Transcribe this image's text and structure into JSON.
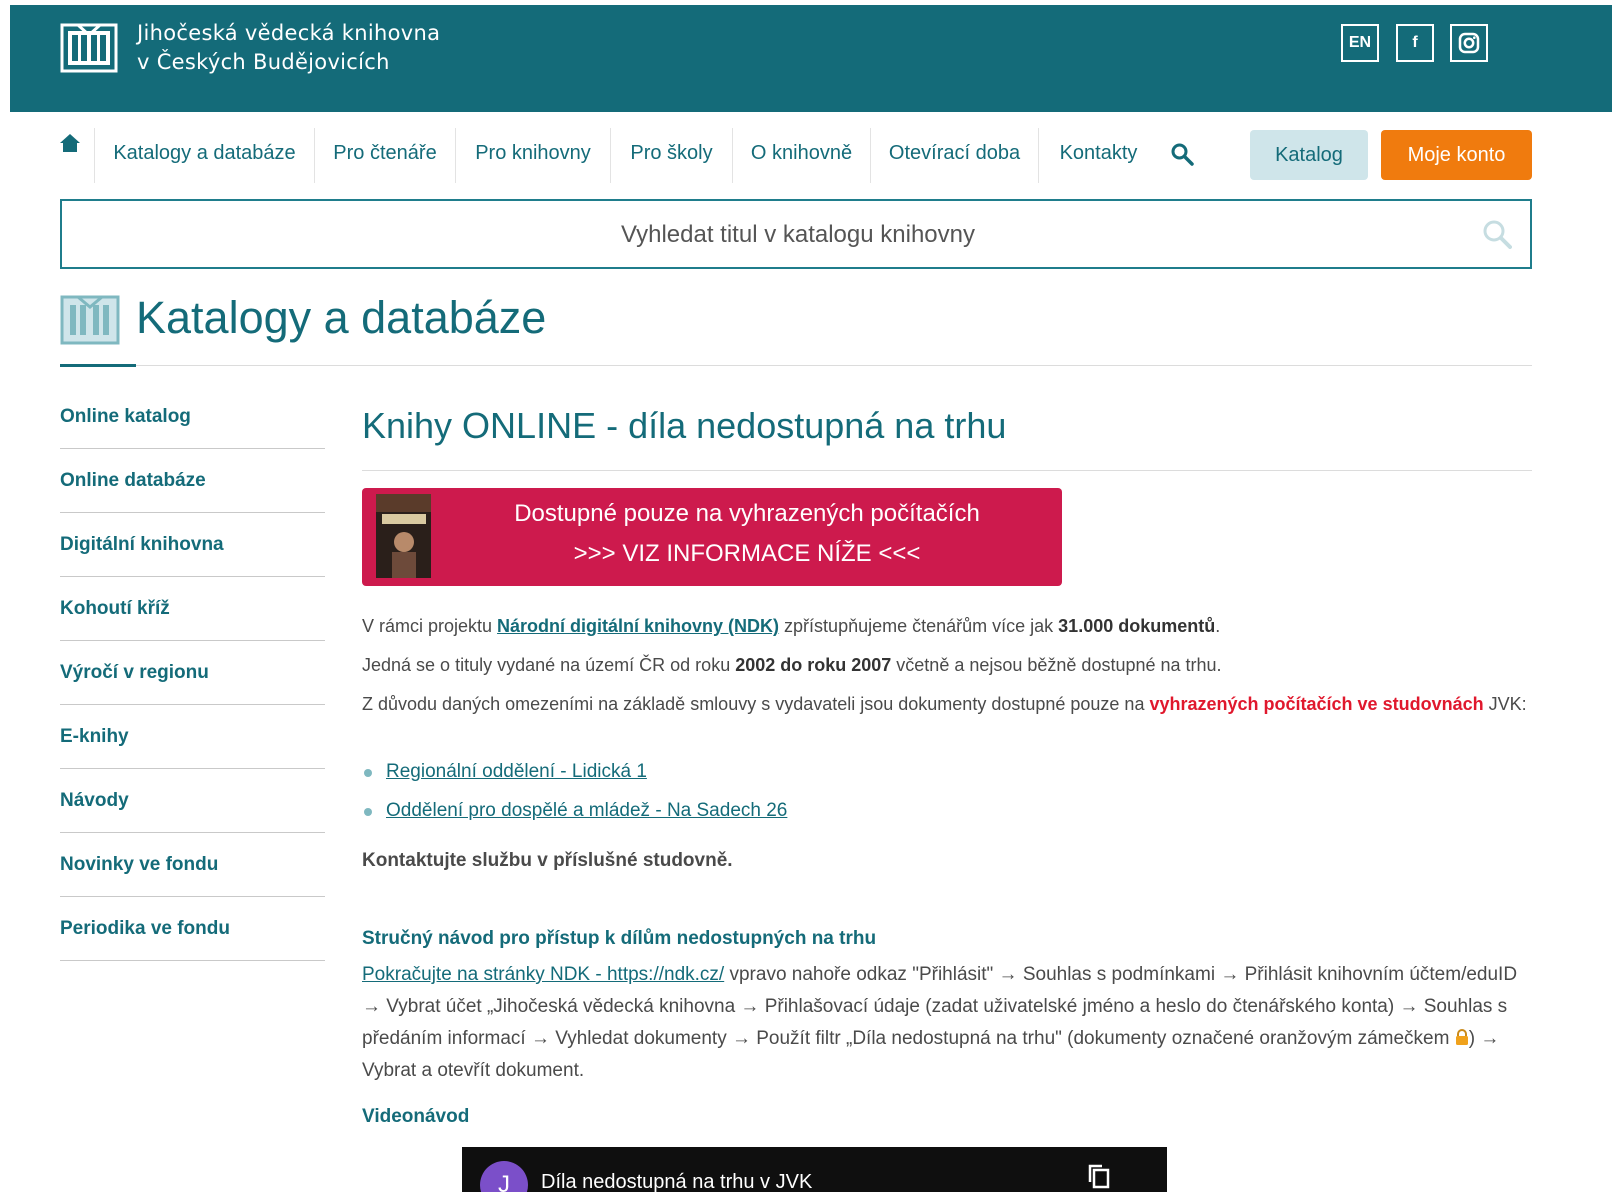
{
  "header": {
    "logo_line1": "Jihočeská vědecká knihovna",
    "logo_line2": "v Českých Budějovicích",
    "lang_label": "EN",
    "facebook_label": "f",
    "brand_color": "#146b79"
  },
  "nav": {
    "items": [
      {
        "label": "Katalogy a databáze"
      },
      {
        "label": "Pro čtenáře"
      },
      {
        "label": "Pro knihovny"
      },
      {
        "label": "Pro školy"
      },
      {
        "label": "O knihovně"
      },
      {
        "label": "Otevírací doba"
      },
      {
        "label": "Kontakty"
      }
    ],
    "katalog_label": "Katalog",
    "konto_label": "Moje konto",
    "konto_color": "#f07b0e"
  },
  "search": {
    "placeholder": "Vyhledat titul v katalogu knihovny"
  },
  "page": {
    "title": "Katalogy a databáze"
  },
  "sidebar": {
    "items": [
      {
        "label": "Online katalog"
      },
      {
        "label": "Online databáze"
      },
      {
        "label": "Digitální knihovna"
      },
      {
        "label": "Kohoutí kříž"
      },
      {
        "label": "Výročí v regionu"
      },
      {
        "label": "E-knihy"
      },
      {
        "label": "Návody"
      },
      {
        "label": "Novinky ve fondu"
      },
      {
        "label": "Periodika ve fondu"
      }
    ]
  },
  "main": {
    "title": "Knihy ONLINE - díla nedostupná na trhu",
    "banner": {
      "line1": "Dostupné pouze na vyhrazených počítačích",
      "line2": ">>> VIZ INFORMACE NÍŽE <<<",
      "color": "#cd1a4d"
    },
    "p1": {
      "before": "V rámci projektu ",
      "link": "Národní digitální knihovny (NDK)",
      "middle": " zpřístupňujeme čtenářům více jak ",
      "bold": "31.000 dokumentů",
      "after": "."
    },
    "p2": {
      "before": "Jedná se o tituly vydané na území ČR od roku ",
      "bold1": "2002 do roku 2007",
      "after": " včetně a nejsou běžně dostupné na trhu."
    },
    "p3": {
      "before": "Z důvodu daných omezeními na základě smlouvy s vydavateli jsou dokumenty dostupné pouze na ",
      "red": "vyhrazených počítačích ve studovnách",
      "after": " JVK:"
    },
    "links": [
      {
        "label": "Regionální oddělení - Lidická 1"
      },
      {
        "label": "Oddělení pro dospělé a mládež - Na Sadech 26"
      }
    ],
    "contact_note": "Kontaktujte službu v příslušné studovně.",
    "guide": {
      "heading": "Stručný návod pro přístup k dílům nedostupných na trhu",
      "link": "Pokračujte na stránky NDK - https://ndk.cz/",
      "text1": " vpravo nahoře odkaz \"Přihlásit\" → Souhlas s podmínkami → Přihlásit knihovním účtem/eduID → Vybrat účet „Jihočeská vědecká knihovna → Přihlašovací údaje (zadat uživatelské jméno a heslo do čtenářského konta) → Souhlas s předáním informací → Vyhledat dokumenty → Použít filtr „Díla nedostupná na trhu\" (dokumenty označené oranžovým zámečkem ",
      "text2": ") → Vybrat a otevřít dokument."
    },
    "video_heading": "Videonávod",
    "video": {
      "avatar_letter": "J",
      "title": "Díla nedostupná na trhu v JVK"
    }
  }
}
